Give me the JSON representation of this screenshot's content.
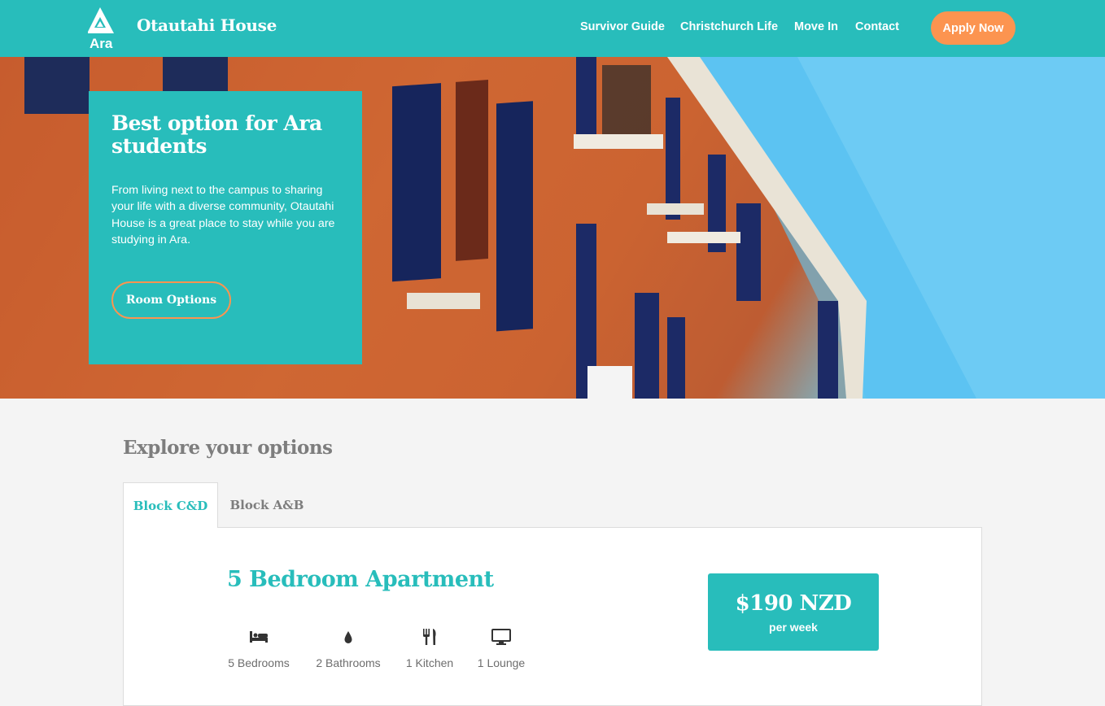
{
  "header": {
    "logo_text": "Ara",
    "brand": "Otautahi House",
    "nav": [
      {
        "label": "Survivor Guide"
      },
      {
        "label": "Christchurch Life"
      },
      {
        "label": "Move In"
      },
      {
        "label": "Contact"
      }
    ],
    "apply_label": "Apply Now"
  },
  "hero": {
    "title": "Best option for Ara students",
    "text": "From living next to the campus to sharing your life with a diverse community, Otautahi House is a great place to stay while you are studying in Ara.",
    "button_label": "Room Options"
  },
  "explore": {
    "title": "Explore your options",
    "tabs": [
      {
        "label": "Block C&D",
        "active": true
      },
      {
        "label": "Block A&B",
        "active": false
      }
    ],
    "apartment": {
      "title": "5 Bedroom Apartment",
      "features": [
        {
          "icon": "bed-icon",
          "label": "5 Bedrooms"
        },
        {
          "icon": "water-drop-icon",
          "label": "2 Bathrooms"
        },
        {
          "icon": "fork-knife-icon",
          "label": "1 Kitchen"
        },
        {
          "icon": "tv-icon",
          "label": "1 Lounge"
        }
      ],
      "price": "$190 NZD",
      "price_period": "per week"
    }
  },
  "colors": {
    "teal": "#28bdbb",
    "orange": "#fc9450",
    "background": "#f4f4f4"
  }
}
